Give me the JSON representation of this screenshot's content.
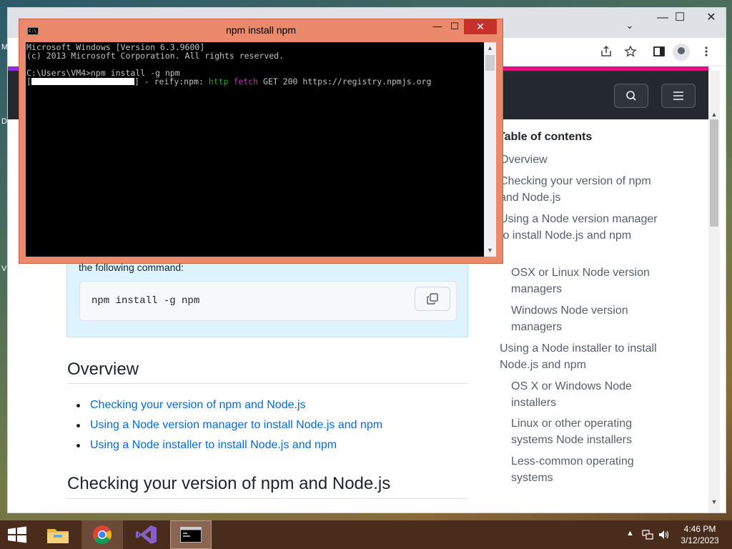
{
  "desktop": {
    "glyphs": [
      "M",
      "D",
      "V"
    ]
  },
  "chrome": {
    "controls": {
      "minimize": "—",
      "maximize": "☐",
      "close": "✕"
    },
    "tab_dropdown": "⌄",
    "toolbar_icons": [
      "share-icon",
      "star-icon",
      "sidepanel-icon",
      "profile-icon",
      "menu-icon"
    ]
  },
  "site": {
    "accent_colors": [
      "#8e2de2",
      "#e0127f"
    ],
    "header_bg": "#24292f",
    "callout": {
      "text": "the following command:",
      "code": "npm install -g npm"
    },
    "overview": {
      "heading": "Overview",
      "links": [
        "Checking your version of npm and Node.js",
        "Using a Node version manager to install Node.js and npm",
        "Using a Node installer to install Node.js and npm"
      ]
    },
    "section_heading": "Checking your version of npm and Node.js",
    "toc": {
      "title": "Table of contents",
      "items": [
        {
          "label": "Overview",
          "level": 1
        },
        {
          "label": "Checking your version of npm and Node.js",
          "level": 1
        },
        {
          "label": "Using a Node version manager to install Node.js and npm",
          "level": 1
        },
        {
          "label": "OSX or Linux Node version managers",
          "level": 2
        },
        {
          "label": "Windows Node version managers",
          "level": 2
        },
        {
          "label": "Using a Node installer to install Node.js and npm",
          "level": 1
        },
        {
          "label": "OS X or Windows Node installers",
          "level": 2
        },
        {
          "label": "Linux or other operating systems Node installers",
          "level": 2
        },
        {
          "label": "Less-common operating systems",
          "level": 2
        }
      ]
    }
  },
  "cmd": {
    "title": "npm install npm",
    "icon_text": "C:\\_",
    "lines": {
      "version": "Microsoft Windows [Version 6.3.9600]",
      "copyright": "(c) 2013 Microsoft Corporation. All rights reserved.",
      "prompt": "C:\\Users\\VM4>npm install -g npm",
      "progress_open": "[",
      "progress_close": "] - reify:npm: ",
      "http": "http",
      "fetch": "fetch",
      "fetch_rest": " GET 200 https://registry.npmjs.org"
    },
    "colors": {
      "http": "#2f9e2f",
      "fetch": "#b03ab0"
    }
  },
  "taskbar": {
    "apps": [
      "file-explorer",
      "chrome",
      "visual-studio",
      "command-prompt"
    ],
    "clock": {
      "time": "4:46 PM",
      "date": "3/12/2023"
    }
  }
}
